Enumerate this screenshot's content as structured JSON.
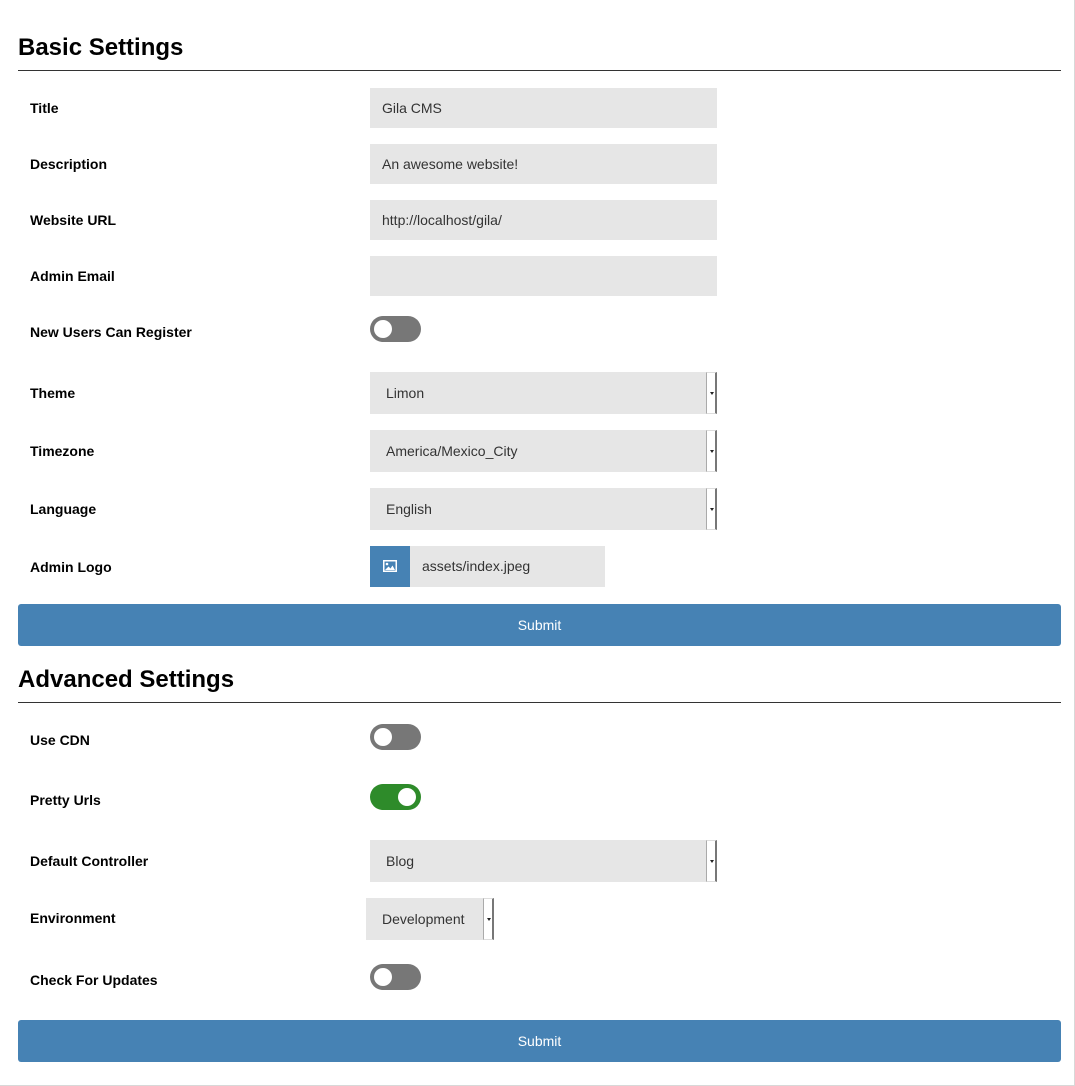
{
  "basic": {
    "heading": "Basic Settings",
    "fields": {
      "title": {
        "label": "Title",
        "value": "Gila CMS"
      },
      "description": {
        "label": "Description",
        "value": "An awesome website!"
      },
      "website_url": {
        "label": "Website URL",
        "value": "http://localhost/gila/"
      },
      "admin_email": {
        "label": "Admin Email",
        "value": ""
      },
      "new_users": {
        "label": "New Users Can Register",
        "enabled": false
      },
      "theme": {
        "label": "Theme",
        "value": "Limon"
      },
      "timezone": {
        "label": "Timezone",
        "value": "America/Mexico_City"
      },
      "language": {
        "label": "Language",
        "value": "English"
      },
      "admin_logo": {
        "label": "Admin Logo",
        "value": "assets/index.jpeg",
        "icon": "image-icon"
      }
    },
    "submit_label": "Submit"
  },
  "advanced": {
    "heading": "Advanced Settings",
    "fields": {
      "use_cdn": {
        "label": "Use CDN",
        "enabled": false
      },
      "pretty_urls": {
        "label": "Pretty Urls",
        "enabled": true
      },
      "default_controller": {
        "label": "Default Controller",
        "value": "Blog"
      },
      "environment": {
        "label": "Environment",
        "value": "Development"
      },
      "check_updates": {
        "label": "Check For Updates",
        "enabled": false
      }
    },
    "submit_label": "Submit"
  },
  "colors": {
    "primary": "#4682b4",
    "toggle_on": "#2e8b2a",
    "toggle_off": "#777777",
    "input_bg": "#e6e6e6"
  }
}
